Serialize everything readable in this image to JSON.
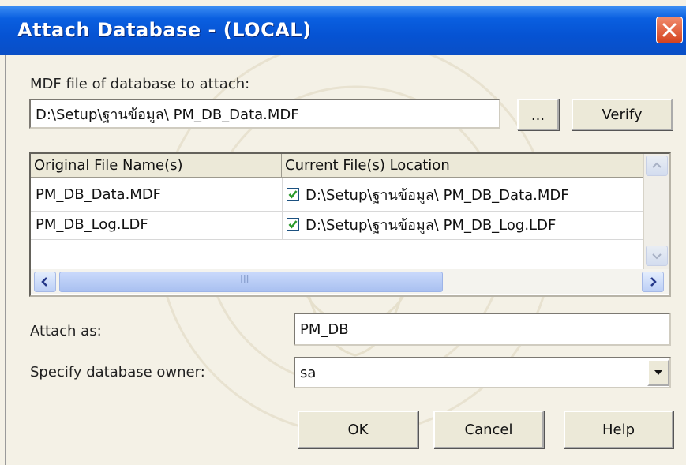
{
  "window": {
    "title": "Attach Database - (LOCAL)"
  },
  "mdf": {
    "label": "MDF file of database to attach:",
    "path": "D:\\Setup\\ฐานข้อมูล\\ PM_DB_Data.MDF",
    "browse_label": "...",
    "verify_label": "Verify"
  },
  "files_table": {
    "columns": [
      "Original File Name(s)",
      "Current File(s) Location"
    ],
    "rows": [
      {
        "original": "PM_DB_Data.MDF",
        "checked": true,
        "location": "D:\\Setup\\ฐานข้อมูล\\ PM_DB_Data.MDF"
      },
      {
        "original": "PM_DB_Log.LDF",
        "checked": true,
        "location": "D:\\Setup\\ฐานข้อมูล\\ PM_DB_Log.LDF"
      }
    ],
    "scroll_grip": "III"
  },
  "attach_as": {
    "label": "Attach as:",
    "value": "PM_DB"
  },
  "owner": {
    "label": "Specify database owner:",
    "value": "sa"
  },
  "buttons": {
    "ok": "OK",
    "cancel": "Cancel",
    "help": "Help"
  },
  "colors": {
    "titlebar": "#0653d3",
    "dialog_bg": "#ece9d8",
    "close": "#d5431f",
    "check": "#2a9a2a"
  }
}
